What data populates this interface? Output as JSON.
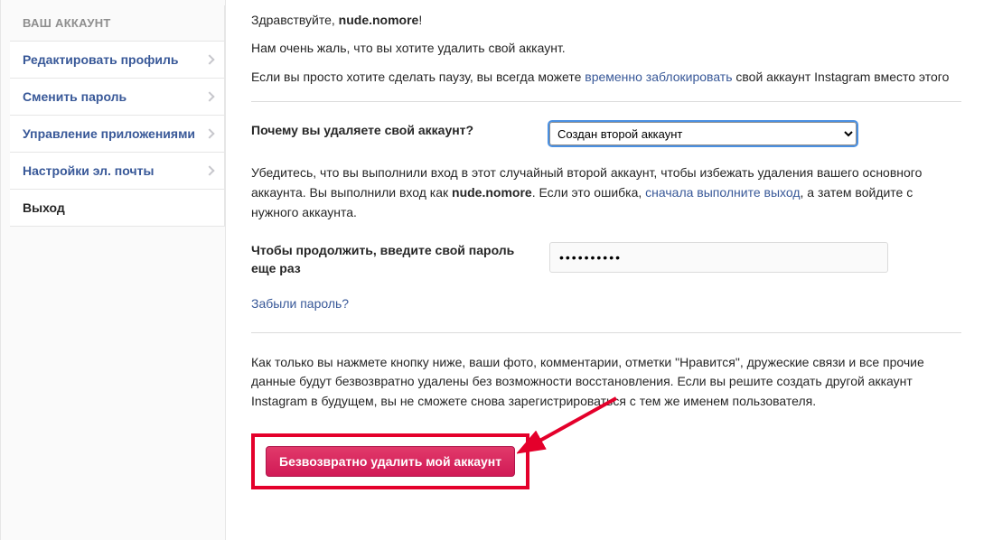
{
  "sidebar": {
    "header": "ВАШ АККАУНТ",
    "items": [
      {
        "label": "Редактировать профиль",
        "chevron": true
      },
      {
        "label": "Сменить пароль",
        "chevron": true
      },
      {
        "label": "Управление приложениями",
        "chevron": true
      },
      {
        "label": "Настройки эл. почты",
        "chevron": true
      },
      {
        "label": "Выход",
        "chevron": false
      }
    ]
  },
  "main": {
    "greeting_prefix": "Здравствуйте, ",
    "username": "nude.nomore",
    "greeting_suffix": "!",
    "sorry": "Нам очень жаль, что вы хотите удалить свой аккаунт.",
    "pause_before": "Если вы просто хотите сделать паузу, вы всегда можете ",
    "pause_link": "временно заблокировать",
    "pause_after": " свой аккаунт Instagram вместо этого",
    "reason_label": "Почему вы удаляете свой аккаунт?",
    "reason_value": "Создан второй аккаунт",
    "warning_p1": "Убедитесь, что вы выполнили вход в этот случайный второй аккаунт, чтобы избежать удаления вашего основного аккаунта. Вы выполнили вход как ",
    "warning_user": "nude.nomore",
    "warning_p2": ". Если это ошибка, ",
    "warning_link": "сначала выполните выход",
    "warning_p3": ", а затем войдите с нужного аккаунта.",
    "password_label": "Чтобы продолжить, введите свой пароль еще раз",
    "password_value": "••••••••••",
    "forgot": "Забыли пароль?",
    "consequence": "Как только вы нажмете кнопку ниже, ваши фото, комментарии, отметки \"Нравится\", дружеские связи и все прочие данные будут безвозвратно удалены без возможности восстановления. Если вы решите создать другой аккаунт Instagram в будущем, вы не сможете снова зарегистрироваться с тем же именем пользователя.",
    "delete_btn": "Безвозвратно удалить мой аккаунт"
  }
}
